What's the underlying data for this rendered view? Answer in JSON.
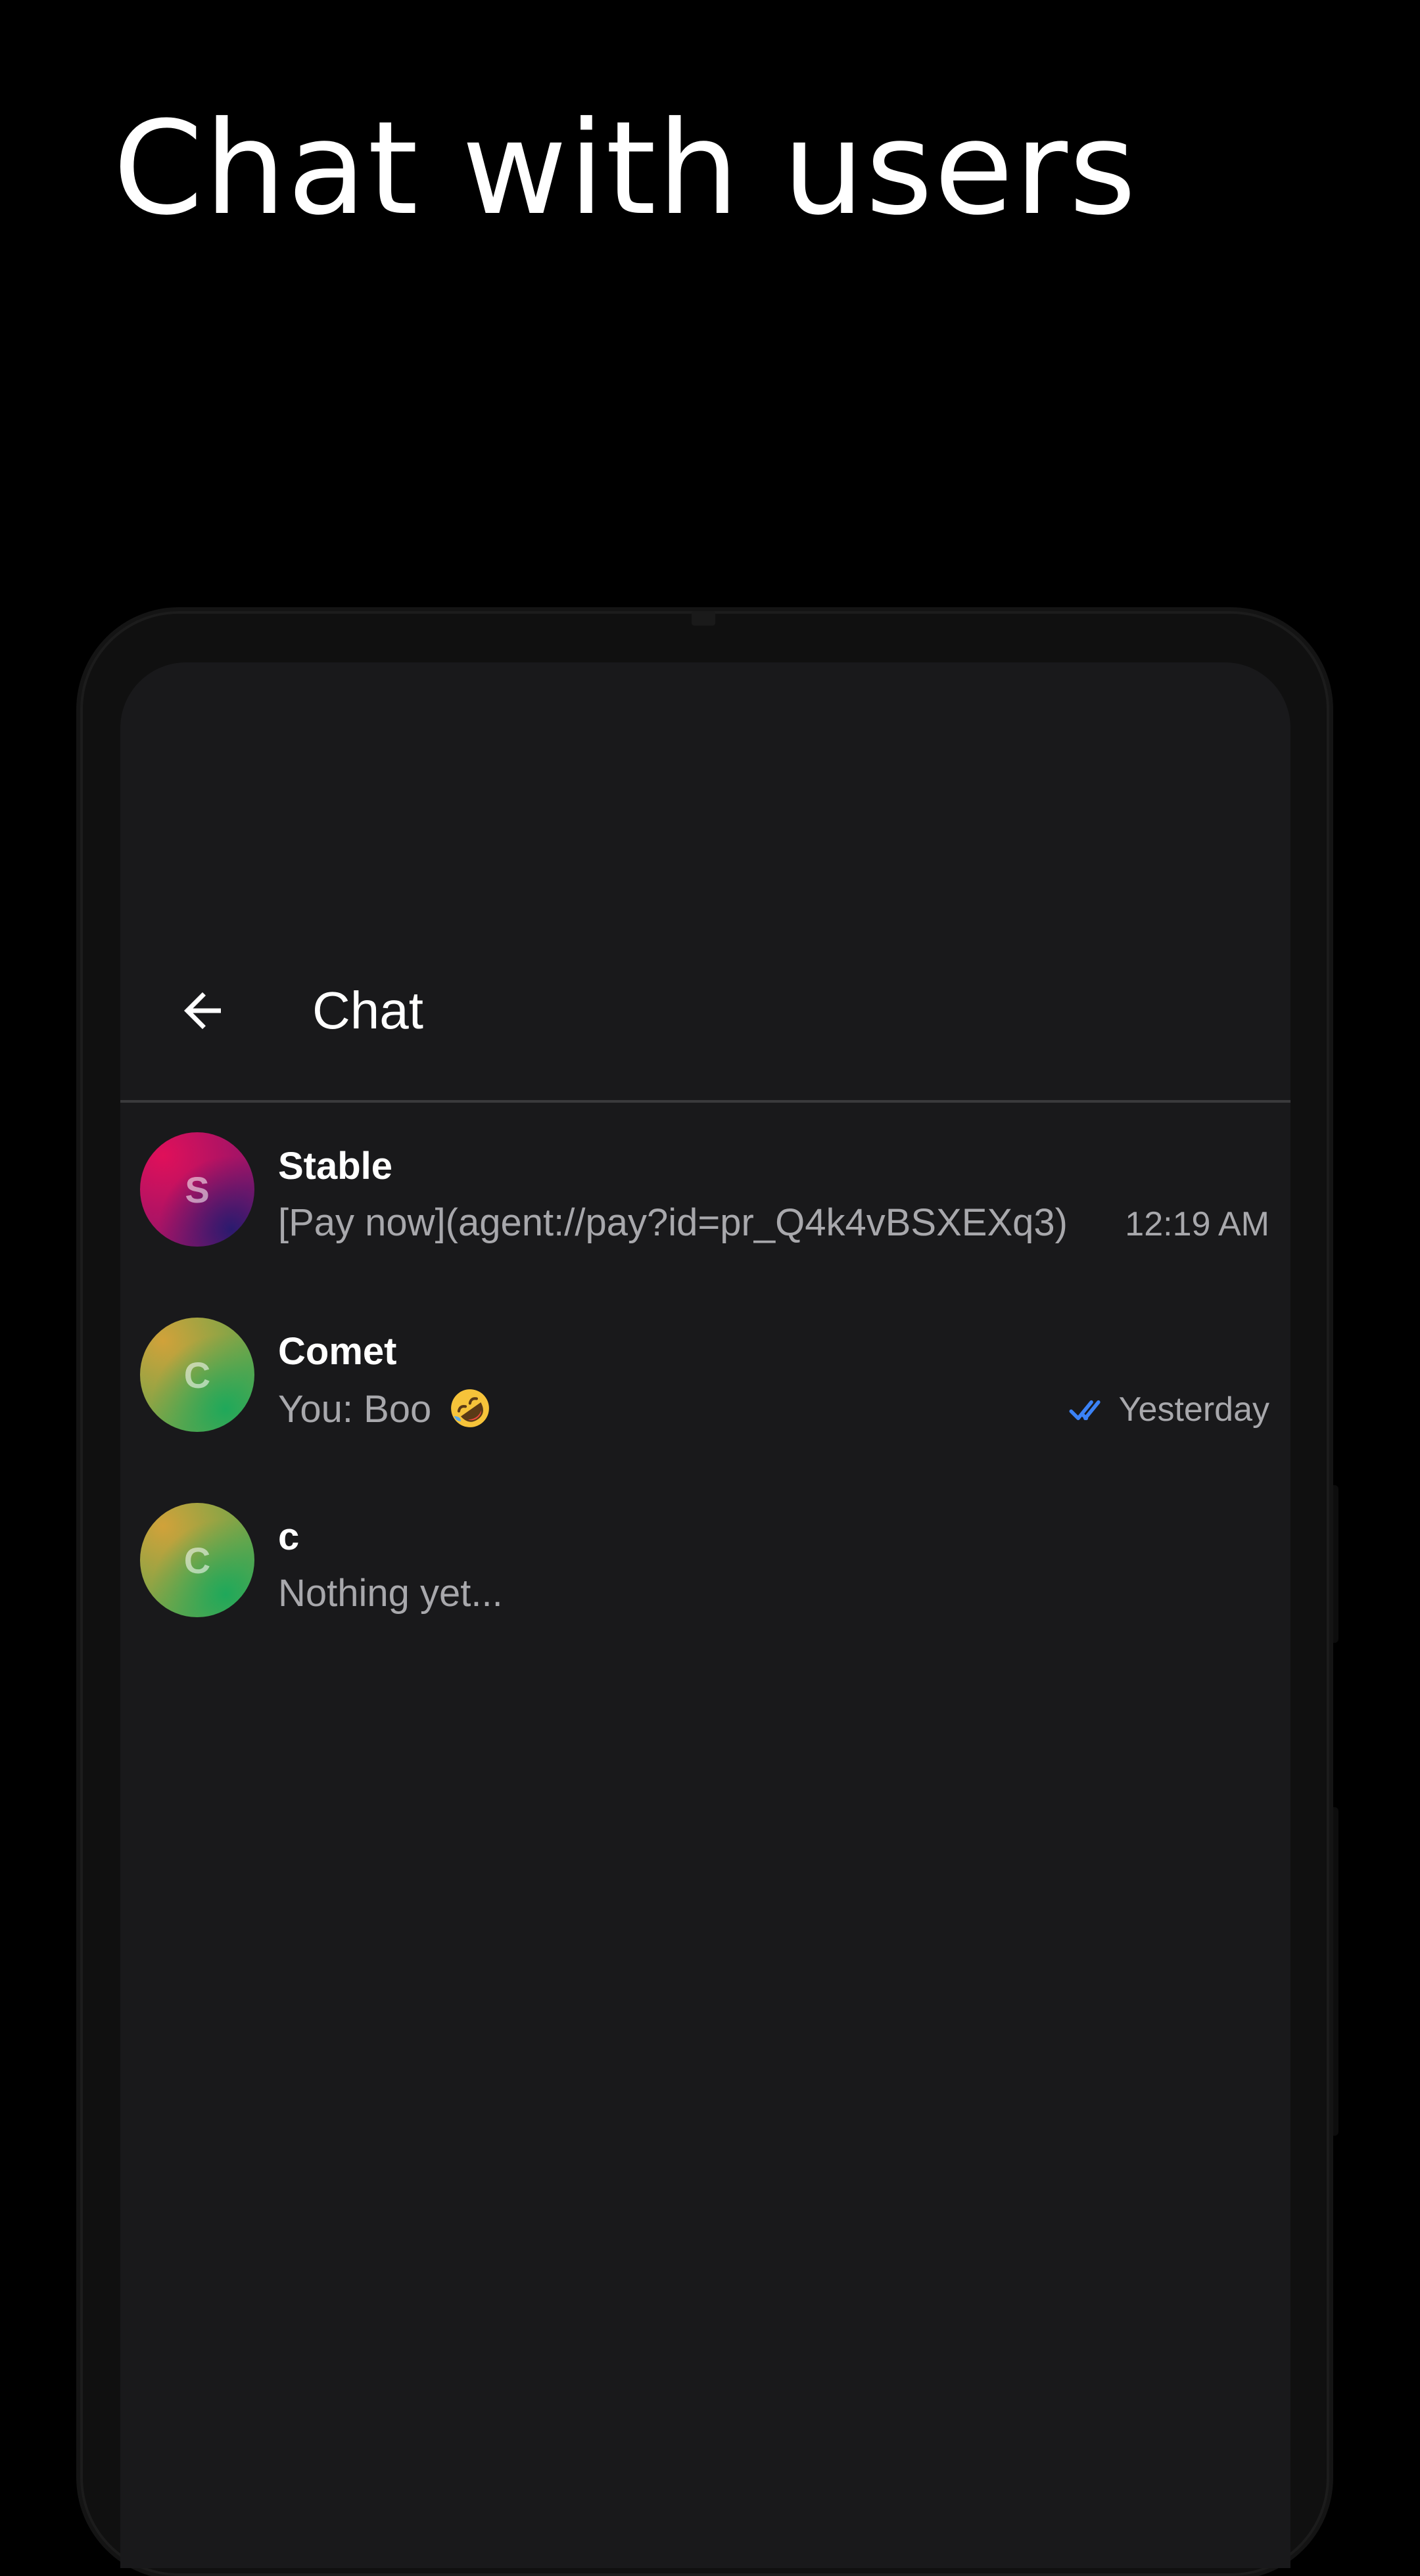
{
  "headline": "Chat with users",
  "app_bar": {
    "title": "Chat",
    "back_icon": "arrow-left-icon"
  },
  "colors": {
    "background": "#000000",
    "screen": "#19191b",
    "read_receipt": "#3b82f6"
  },
  "chats": [
    {
      "name": "Stable",
      "initial": "S",
      "preview": "[Pay now](agent://pay?id=pr_Q4k4vBSXEXq3)",
      "time": "12:19 AM"
    },
    {
      "name": "Comet",
      "initial": "C",
      "preview": "You:  Boo",
      "preview_emoji": "rolling-on-floor-laughing-emoji-icon",
      "time": "Yesterday",
      "status_icon": "double-check-icon"
    },
    {
      "name": "c",
      "initial": "C",
      "preview": "Nothing yet..."
    }
  ]
}
